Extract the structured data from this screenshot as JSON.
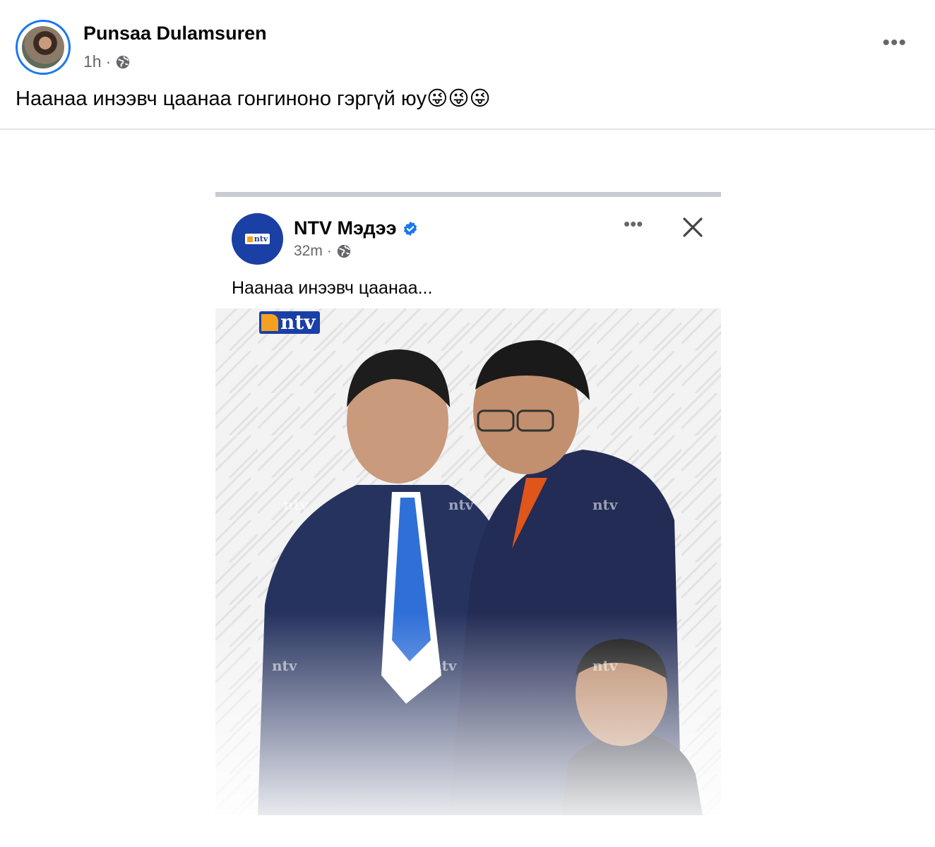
{
  "post": {
    "author": "Punsaa Dulamsuren",
    "time": "1h",
    "separator": "·",
    "caption": "Наанаа инээвч цаанаа гонгиноно гэргүй юу😜😜😜"
  },
  "shared": {
    "page_name": "NTV Мэдээ",
    "time": "32m",
    "separator": "·",
    "text": "Наанаа инээвч цаанаа...",
    "logo_text": "ntv",
    "watermark_text": "ntv"
  },
  "icons": {
    "globe": "globe-icon",
    "more": "more-options-icon",
    "verified": "verified-badge-icon",
    "close": "close-icon"
  },
  "colors": {
    "accent": "#1877f2",
    "ntv_blue": "#1a3fa5",
    "ntv_orange": "#f4a020",
    "meta_gray": "#65676b"
  }
}
